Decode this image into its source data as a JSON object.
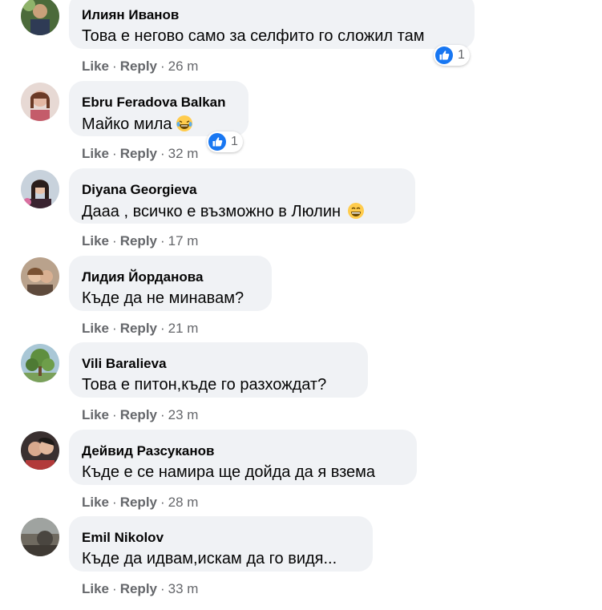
{
  "comments": [
    {
      "author": "Илиян Иванов",
      "text": "Това е негово само за селфито го сложил там",
      "like": "Like",
      "reply": "Reply",
      "time": "26 m",
      "reactions": "1",
      "emoji": ""
    },
    {
      "author": "Ebru Feradova Balkan",
      "text": "Майко мила",
      "like": "Like",
      "reply": "Reply",
      "time": "32 m",
      "reactions": "1",
      "emoji": "laughing-tears-emoji"
    },
    {
      "author": "Diyana Georgieva",
      "text": "Дааа , всичко е възможно в Люлин",
      "like": "Like",
      "reply": "Reply",
      "time": "17 m",
      "reactions": "",
      "emoji": "grinning-emoji"
    },
    {
      "author": "Лидия Йорданова",
      "text": "Къде да не минавам?",
      "like": "Like",
      "reply": "Reply",
      "time": "21 m",
      "reactions": "",
      "emoji": ""
    },
    {
      "author": "Vili Baralieva",
      "text": "Това е питон,къде го разхождат?",
      "like": "Like",
      "reply": "Reply",
      "time": "23 m",
      "reactions": "",
      "emoji": ""
    },
    {
      "author": "Дейвид Разсуканов",
      "text": "Къде е се намира ще дойда да я взема",
      "like": "Like",
      "reply": "Reply",
      "time": "28 m",
      "reactions": "",
      "emoji": ""
    },
    {
      "author": "Emil Nikolov",
      "text": "Къде да идвам,искам да го видя...",
      "like": "Like",
      "reply": "Reply",
      "time": "33 m",
      "reactions": "",
      "emoji": ""
    }
  ],
  "colors": {
    "bubble": "#f0f2f5",
    "meta": "#65676b",
    "like_blue": "#1877f2"
  },
  "separator": "·"
}
